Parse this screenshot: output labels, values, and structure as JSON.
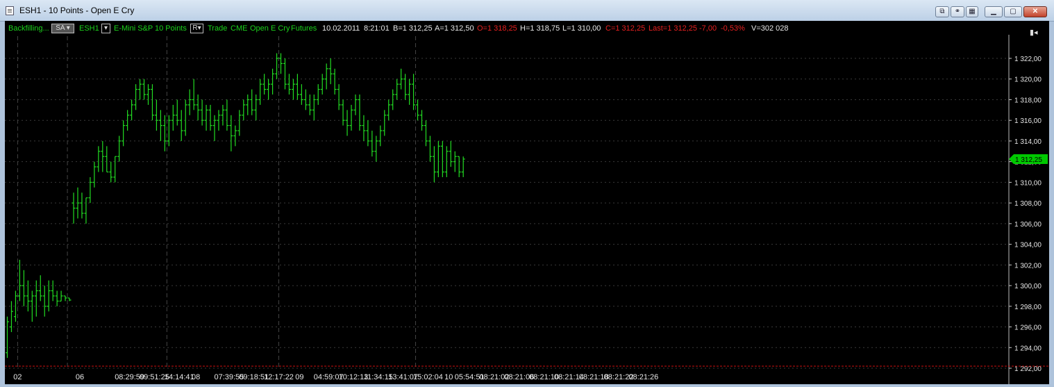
{
  "window": {
    "title": "ESH1 - 10 Points - Open E Cry"
  },
  "infobar": {
    "backfilling": "Backfilling...",
    "sa_button": "SA",
    "symbol": "ESH1",
    "instrument": "E-Mini S&P",
    "interval": "10 Points",
    "r_button": "R",
    "trade": "Trade",
    "exchange": "CME",
    "broker": "Open E Cry",
    "type": "Futures",
    "date": "10.02.2011",
    "time": "8:21:01",
    "bid": "B=1 312,25",
    "ask": "A=1 312,50",
    "open": "O=1 318,25",
    "high": "H=1 318,75",
    "low": "L=1 310,00",
    "close": "C=1 312,25",
    "last": "Last=1 312,25",
    "change": "-7,00",
    "change_pct": "-0,53%",
    "volume": "V=302 028"
  },
  "colors": {
    "bar": "#22dd22",
    "green_text": "#1bd31b",
    "red_text": "#e82020",
    "white_text": "#e8e8e8",
    "grid": "#3a3a3a",
    "last_tag": "#00c800"
  },
  "chart_data": {
    "type": "ohlc",
    "y_axis": {
      "ticks": [
        "1 292,00",
        "1 294,00",
        "1 296,00",
        "1 298,00",
        "1 300,00",
        "1 302,00",
        "1 304,00",
        "1 306,00",
        "1 308,00",
        "1 310,00",
        "1 312,00",
        "1 314,00",
        "1 316,00",
        "1 318,00",
        "1 320,00",
        "1 322,00"
      ],
      "tick_values": [
        1292,
        1294,
        1296,
        1298,
        1300,
        1302,
        1304,
        1306,
        1308,
        1310,
        1312,
        1314,
        1316,
        1318,
        1320,
        1322
      ],
      "ylim": [
        1292,
        1324
      ]
    },
    "last_price": 1312.25,
    "last_label": "1 312,25",
    "x_labels": [
      {
        "bar": 2.5,
        "text": "02"
      },
      {
        "bar": 17.5,
        "text": "06"
      },
      {
        "bar": 29.5,
        "text": "08:29:59"
      },
      {
        "bar": 35.5,
        "text": "09:51:25"
      },
      {
        "bar": 41.5,
        "text": "14:14:41"
      },
      {
        "bar": 45.5,
        "text": "08"
      },
      {
        "bar": 53.5,
        "text": "07:39:55"
      },
      {
        "bar": 59.5,
        "text": "09:18:51"
      },
      {
        "bar": 65.5,
        "text": "12:17:22"
      },
      {
        "bar": 70.5,
        "text": "09"
      },
      {
        "bar": 77.5,
        "text": "04:59:07"
      },
      {
        "bar": 83.5,
        "text": "10:12:13"
      },
      {
        "bar": 89.5,
        "text": "11:34:15"
      },
      {
        "bar": 95.5,
        "text": "13:41:07"
      },
      {
        "bar": 101.5,
        "text": "15:02:04"
      },
      {
        "bar": 106.5,
        "text": "10"
      },
      {
        "bar": 111.5,
        "text": "05:54:51"
      },
      {
        "bar": 117.5,
        "text": "08:21:02"
      },
      {
        "bar": 123.5,
        "text": "08:21:06"
      },
      {
        "bar": 129.5,
        "text": "08:21:10"
      },
      {
        "bar": 135.5,
        "text": "08:21:14"
      },
      {
        "bar": 141.5,
        "text": "08:21:18"
      },
      {
        "bar": 147.5,
        "text": "08:21:22"
      },
      {
        "bar": 153.5,
        "text": "08:21:26"
      }
    ],
    "session_breaks": [
      2.5,
      14.5,
      38.5,
      65.5,
      98.5
    ],
    "ohlc": [
      [
        1293.5,
        1297.0,
        1293.0,
        1296.5
      ],
      [
        1296.0,
        1298.5,
        1295.5,
        1297.5
      ],
      [
        1297.0,
        1299.5,
        1296.5,
        1299.0
      ],
      [
        1299.0,
        1302.5,
        1298.5,
        1300.0
      ],
      [
        1300.0,
        1301.5,
        1298.0,
        1299.0
      ],
      [
        1299.0,
        1300.5,
        1297.5,
        1298.5
      ],
      [
        1298.5,
        1299.5,
        1296.5,
        1299.0
      ],
      [
        1299.0,
        1300.5,
        1297.0,
        1299.5
      ],
      [
        1299.5,
        1301.0,
        1298.5,
        1299.0
      ],
      [
        1299.0,
        1300.0,
        1297.0,
        1298.0
      ],
      [
        1298.0,
        1300.5,
        1297.5,
        1299.5
      ],
      [
        1299.5,
        1300.5,
        1298.5,
        1299.0
      ],
      [
        1299.0,
        1299.5,
        1298.0,
        1298.5
      ],
      [
        1298.5,
        1299.5,
        1298.5,
        1299.0
      ],
      [
        1299.0,
        1299.0,
        1298.5,
        1298.8
      ],
      [
        1298.8,
        1298.8,
        1298.5,
        1298.6
      ],
      [
        1308.0,
        1309.0,
        1306.0,
        1307.5
      ],
      [
        1307.5,
        1309.5,
        1306.5,
        1308.0
      ],
      [
        1308.0,
        1309.0,
        1306.5,
        1307.0
      ],
      [
        1307.0,
        1308.5,
        1306.0,
        1308.5
      ],
      [
        1308.5,
        1310.5,
        1308.0,
        1310.0
      ],
      [
        1310.0,
        1312.0,
        1309.5,
        1311.5
      ],
      [
        1311.5,
        1313.5,
        1311.0,
        1313.0
      ],
      [
        1313.0,
        1314.0,
        1311.0,
        1312.5
      ],
      [
        1312.5,
        1313.5,
        1311.0,
        1311.0
      ],
      [
        1311.0,
        1312.0,
        1310.0,
        1310.5
      ],
      [
        1310.5,
        1312.5,
        1310.0,
        1312.5
      ],
      [
        1312.5,
        1314.5,
        1312.0,
        1314.0
      ],
      [
        1314.0,
        1316.0,
        1313.5,
        1315.5
      ],
      [
        1315.5,
        1317.0,
        1315.0,
        1316.5
      ],
      [
        1316.5,
        1318.0,
        1316.0,
        1317.5
      ],
      [
        1317.5,
        1319.5,
        1317.0,
        1319.0
      ],
      [
        1319.0,
        1320.0,
        1318.0,
        1319.5
      ],
      [
        1319.5,
        1320.0,
        1318.0,
        1318.5
      ],
      [
        1318.5,
        1319.5,
        1317.5,
        1319.0
      ],
      [
        1319.0,
        1319.5,
        1316.0,
        1316.5
      ],
      [
        1316.5,
        1318.0,
        1315.0,
        1316.0
      ],
      [
        1316.0,
        1317.0,
        1314.0,
        1315.5
      ],
      [
        1315.5,
        1316.5,
        1313.0,
        1314.0
      ],
      [
        1314.0,
        1316.5,
        1313.5,
        1316.0
      ],
      [
        1316.0,
        1317.5,
        1315.0,
        1316.5
      ],
      [
        1316.5,
        1318.0,
        1315.5,
        1316.0
      ],
      [
        1316.0,
        1317.0,
        1314.0,
        1315.0
      ],
      [
        1315.0,
        1318.0,
        1314.5,
        1317.5
      ],
      [
        1317.5,
        1319.0,
        1316.5,
        1318.0
      ],
      [
        1318.0,
        1320.0,
        1317.0,
        1317.5
      ],
      [
        1317.5,
        1318.5,
        1316.0,
        1317.0
      ],
      [
        1317.0,
        1318.0,
        1315.5,
        1316.0
      ],
      [
        1316.0,
        1317.5,
        1315.0,
        1317.0
      ],
      [
        1317.0,
        1317.5,
        1315.0,
        1315.5
      ],
      [
        1315.5,
        1316.5,
        1314.0,
        1316.0
      ],
      [
        1316.0,
        1317.0,
        1315.0,
        1316.5
      ],
      [
        1316.5,
        1317.5,
        1315.5,
        1317.0
      ],
      [
        1317.0,
        1318.0,
        1315.0,
        1315.5
      ],
      [
        1315.5,
        1316.5,
        1313.0,
        1314.5
      ],
      [
        1314.5,
        1315.5,
        1313.5,
        1315.0
      ],
      [
        1315.0,
        1317.0,
        1314.5,
        1316.5
      ],
      [
        1316.5,
        1318.0,
        1316.0,
        1317.5
      ],
      [
        1317.5,
        1318.5,
        1316.5,
        1318.0
      ],
      [
        1318.0,
        1319.0,
        1316.5,
        1317.0
      ],
      [
        1317.0,
        1318.5,
        1316.0,
        1318.0
      ],
      [
        1318.0,
        1320.0,
        1317.5,
        1319.5
      ],
      [
        1319.5,
        1320.5,
        1318.5,
        1319.0
      ],
      [
        1319.0,
        1320.0,
        1318.0,
        1319.5
      ],
      [
        1319.5,
        1321.0,
        1318.5,
        1320.5
      ],
      [
        1320.5,
        1322.5,
        1320.0,
        1322.0
      ],
      [
        1322.0,
        1322.5,
        1320.5,
        1321.5
      ],
      [
        1321.5,
        1322.0,
        1319.0,
        1319.5
      ],
      [
        1319.5,
        1320.5,
        1318.5,
        1319.0
      ],
      [
        1319.0,
        1320.0,
        1318.0,
        1319.5
      ],
      [
        1319.5,
        1320.5,
        1318.0,
        1318.5
      ],
      [
        1318.5,
        1319.5,
        1317.5,
        1318.0
      ],
      [
        1318.0,
        1319.0,
        1317.0,
        1317.5
      ],
      [
        1317.5,
        1318.5,
        1316.5,
        1317.0
      ],
      [
        1317.0,
        1318.5,
        1316.0,
        1318.0
      ],
      [
        1318.0,
        1319.5,
        1317.5,
        1319.0
      ],
      [
        1319.0,
        1320.5,
        1318.5,
        1320.0
      ],
      [
        1320.0,
        1321.5,
        1319.0,
        1321.0
      ],
      [
        1321.0,
        1322.0,
        1319.5,
        1320.5
      ],
      [
        1320.5,
        1321.0,
        1318.5,
        1319.0
      ],
      [
        1319.0,
        1319.5,
        1317.0,
        1317.5
      ],
      [
        1317.5,
        1318.0,
        1315.5,
        1316.0
      ],
      [
        1316.0,
        1317.0,
        1314.5,
        1315.5
      ],
      [
        1315.5,
        1317.5,
        1315.0,
        1317.0
      ],
      [
        1317.0,
        1318.5,
        1316.5,
        1318.0
      ],
      [
        1318.0,
        1318.5,
        1315.0,
        1315.5
      ],
      [
        1315.5,
        1316.5,
        1314.0,
        1315.0
      ],
      [
        1315.0,
        1316.0,
        1313.5,
        1314.0
      ],
      [
        1314.0,
        1315.0,
        1312.5,
        1313.0
      ],
      [
        1313.0,
        1314.5,
        1312.0,
        1314.0
      ],
      [
        1314.0,
        1315.5,
        1313.5,
        1315.0
      ],
      [
        1315.0,
        1317.0,
        1314.5,
        1316.5
      ],
      [
        1316.5,
        1318.0,
        1316.0,
        1317.5
      ],
      [
        1317.5,
        1319.0,
        1317.0,
        1318.5
      ],
      [
        1318.5,
        1320.0,
        1318.0,
        1319.5
      ],
      [
        1319.5,
        1321.0,
        1319.0,
        1320.0
      ],
      [
        1320.0,
        1320.5,
        1318.0,
        1318.5
      ],
      [
        1318.5,
        1320.0,
        1317.5,
        1319.5
      ],
      [
        1319.5,
        1320.5,
        1317.0,
        1317.5
      ],
      [
        1317.5,
        1318.0,
        1316.0,
        1316.5
      ],
      [
        1316.5,
        1317.0,
        1315.0,
        1315.5
      ],
      [
        1315.5,
        1316.0,
        1313.5,
        1314.0
      ],
      [
        1314.0,
        1314.5,
        1312.0,
        1312.5
      ],
      [
        1312.5,
        1313.5,
        1310.0,
        1311.0
      ],
      [
        1311.0,
        1314.0,
        1310.5,
        1313.5
      ],
      [
        1313.5,
        1314.0,
        1310.5,
        1311.0
      ],
      [
        1311.0,
        1313.5,
        1310.5,
        1313.0
      ],
      [
        1313.0,
        1314.0,
        1311.5,
        1312.0
      ],
      [
        1312.0,
        1313.0,
        1311.0,
        1312.5
      ],
      [
        1312.5,
        1312.5,
        1310.5,
        1311.0
      ],
      [
        1311.0,
        1312.5,
        1310.5,
        1312.25
      ]
    ]
  }
}
